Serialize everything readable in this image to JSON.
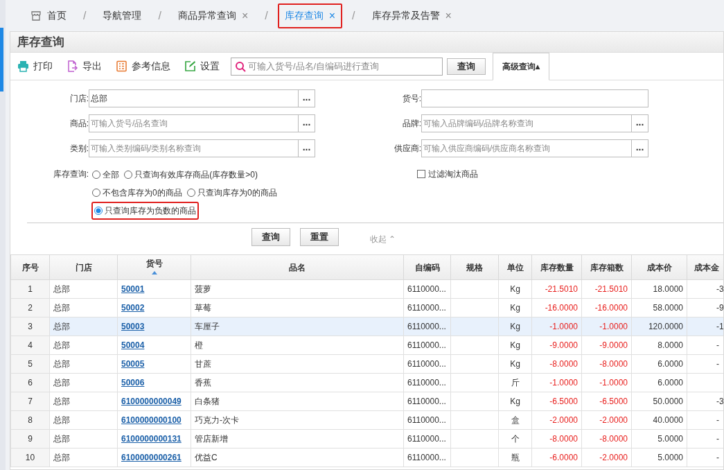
{
  "breadcrumb": [
    {
      "label": "首页",
      "kind": "home",
      "separator": "/",
      "selected": false,
      "annotated": false
    },
    {
      "label": "导航管理",
      "kind": "tab",
      "separator": "/",
      "selected": false,
      "annotated": false
    },
    {
      "label": "商品异常查询",
      "kind": "tab",
      "close": "×",
      "separator": "/",
      "selected": false,
      "annotated": false
    },
    {
      "label": "库存查询",
      "kind": "tab",
      "close": "×",
      "separator": "/",
      "selected": true,
      "annotated": true
    },
    {
      "label": "库存异常及告警",
      "kind": "tab",
      "close": "×",
      "selected": false,
      "annotated": false
    }
  ],
  "panel_title": "库存查询",
  "toolbar": [
    {
      "label": "打印",
      "kind": "print"
    },
    {
      "label": "导出",
      "kind": "export"
    },
    {
      "label": "参考信息",
      "kind": "info"
    },
    {
      "label": "设置",
      "kind": "settings"
    }
  ],
  "search": {
    "placeholder": "可输入货号/品名/自编码进行查询",
    "button": "查询",
    "advanced": "高级查询▴"
  },
  "form": {
    "fields": [
      {
        "label": "门店:",
        "value": "总部",
        "browse": "..."
      },
      {
        "label": "货号:"
      },
      {
        "label": "商品:",
        "placeholder": "可输入货号/品名查询",
        "browse": "..."
      },
      {
        "label": "品牌:",
        "placeholder": "可输入品牌编码/品牌名称查询",
        "browse": "..."
      },
      {
        "label": "类别:",
        "placeholder": "可输入类别编码/类别名称查询",
        "browse": "..."
      },
      {
        "label": "供应商:",
        "placeholder": "可输入供应商编码/供应商名称查询",
        "browse": "..."
      }
    ],
    "stock_label": "库存查询:",
    "stock_options": [
      {
        "label": "全部",
        "selected": false,
        "annotated": false
      },
      {
        "label": "只查询有效库存商品(库存数量>0)",
        "selected": false,
        "annotated": false
      },
      {
        "label": "不包含库存为0的商品",
        "selected": false,
        "annotated": false
      },
      {
        "label": "只查询库存为0的商品",
        "selected": false,
        "annotated": false
      },
      {
        "label": "只查询库存为负数的商品",
        "selected": true,
        "annotated": true
      }
    ],
    "filter_discontinued": {
      "label": "过滤淘汰商品",
      "checked": false
    },
    "buttons": [
      "查询",
      "重置"
    ],
    "collapse": "收起 ⌃"
  },
  "table": {
    "columns": [
      "序号",
      "门店",
      "货号",
      "品名",
      "自编码",
      "规格",
      "单位",
      "库存数量",
      "库存箱数",
      "成本价",
      "成本金"
    ],
    "rows": [
      {
        "cells": [
          "1",
          "总部",
          "50001",
          "菠萝",
          "6110000...",
          "",
          "Kg",
          "-21.5010",
          "-21.5010",
          "18.0000",
          "-3"
        ],
        "selected": false
      },
      {
        "cells": [
          "2",
          "总部",
          "50002",
          "草莓",
          "6110000...",
          "",
          "Kg",
          "-16.0000",
          "-16.0000",
          "58.0000",
          "-9"
        ],
        "selected": false
      },
      {
        "cells": [
          "3",
          "总部",
          "50003",
          "车厘子",
          "6110000...",
          "",
          "Kg",
          "-1.0000",
          "-1.0000",
          "120.0000",
          "-1"
        ],
        "selected": true
      },
      {
        "cells": [
          "4",
          "总部",
          "50004",
          "橙",
          "6110000...",
          "",
          "Kg",
          "-9.0000",
          "-9.0000",
          "8.0000",
          "-"
        ],
        "selected": false
      },
      {
        "cells": [
          "5",
          "总部",
          "50005",
          "甘蔗",
          "6110000...",
          "",
          "Kg",
          "-8.0000",
          "-8.0000",
          "6.0000",
          "-"
        ],
        "selected": false
      },
      {
        "cells": [
          "6",
          "总部",
          "50006",
          "香蕉",
          "6110000...",
          "",
          "斤",
          "-1.0000",
          "-1.0000",
          "6.0000",
          ""
        ],
        "selected": false
      },
      {
        "cells": [
          "7",
          "总部",
          "6100000000049",
          "白条猪",
          "6110000...",
          "",
          "Kg",
          "-6.5000",
          "-6.5000",
          "50.0000",
          "-3"
        ],
        "selected": false
      },
      {
        "cells": [
          "8",
          "总部",
          "6100000000100",
          "巧克力-次卡",
          "6110000...",
          "",
          "盒",
          "-2.0000",
          "-2.0000",
          "40.0000",
          "-"
        ],
        "selected": false
      },
      {
        "cells": [
          "9",
          "总部",
          "6100000000131",
          "管店新增",
          "6110000...",
          "",
          "个",
          "-8.0000",
          "-8.0000",
          "5.0000",
          "-"
        ],
        "selected": false
      },
      {
        "cells": [
          "10",
          "总部",
          "6100000000261",
          "优益C",
          "6110000...",
          "",
          "瓶",
          "-6.0000",
          "-2.0000",
          "5.0000",
          "-"
        ],
        "selected": false
      }
    ]
  }
}
